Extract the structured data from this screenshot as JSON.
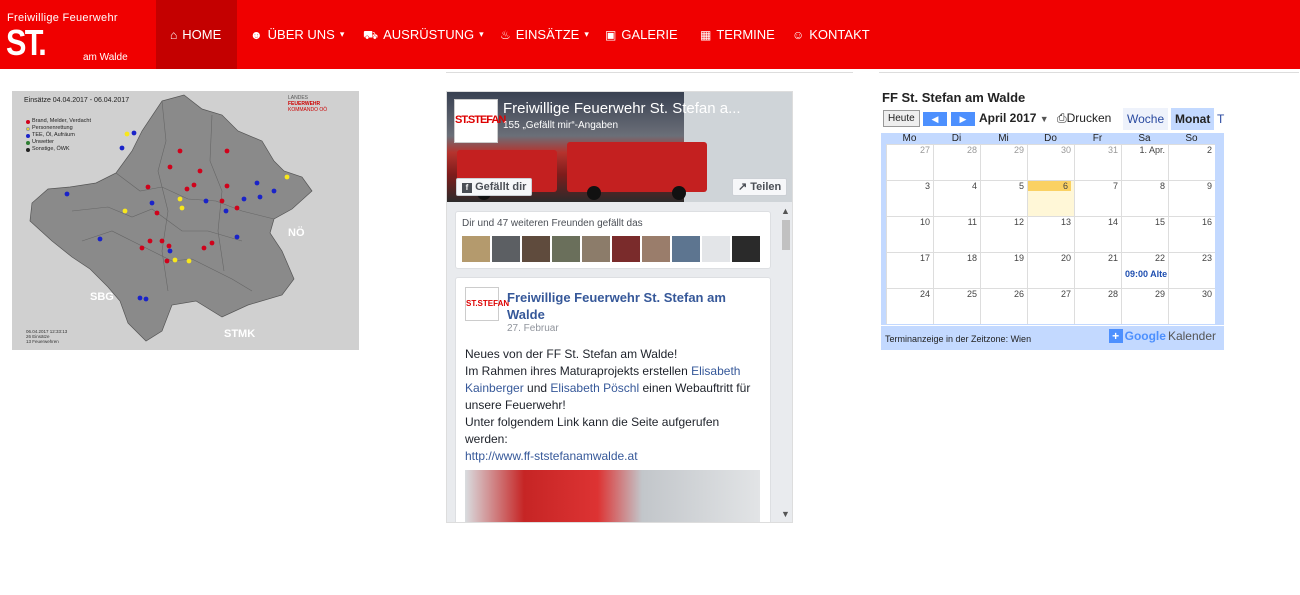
{
  "logo": {
    "top": "Freiwillige Feuerwehr",
    "main": "ST. STEFAN",
    "sub": "am Walde"
  },
  "nav": [
    {
      "icon": "home-icon",
      "glyph": "⌂",
      "label": "HOME",
      "active": true
    },
    {
      "icon": "users-icon",
      "glyph": "☻",
      "label": "ÜBER UNS",
      "caret": "▾"
    },
    {
      "icon": "truck-icon",
      "glyph": "⛟",
      "label": "AUSRÜSTUNG",
      "caret": "▾"
    },
    {
      "icon": "fire-icon",
      "glyph": "♨",
      "label": "EINSÄTZE",
      "caret": "▾"
    },
    {
      "icon": "picture-icon",
      "glyph": "▣",
      "label": "GALERIE"
    },
    {
      "icon": "calendar-icon",
      "glyph": "▦",
      "label": "TERMINE"
    },
    {
      "icon": "user-plus-icon",
      "glyph": "☺",
      "label": "KONTAKT"
    }
  ],
  "map": {
    "title": "Einsätze 04.04.2017 - 06.04.2017",
    "legend": [
      {
        "label": "Brand, Melder, Verdacht",
        "color": "#d0021b"
      },
      {
        "label": "Personenrettung",
        "color": "#f8e71c"
      },
      {
        "label": "TEE, Öl, Aufräum",
        "color": "#1a23c9"
      },
      {
        "label": "Unwetter",
        "color": "#2e7d32"
      },
      {
        "label": "Sonstige, ÖWK",
        "color": "#222222"
      }
    ],
    "badge": [
      "LANDES",
      "FEUERWEHR",
      "KOMMANDO OÖ"
    ],
    "footer": [
      "06.04.2017 12:33:13",
      "26 Einsätze",
      "13 Feuerwehren"
    ],
    "labels": {
      "bavaria": "",
      "noe": "NÖ",
      "sbg": "SBG",
      "stmk": "STMK"
    }
  },
  "facebook": {
    "page_name": "Freiwillige Feuerwehr St. Stefan a...",
    "likes": "155 „Gefällt mir“-Angaben",
    "like_button": "Gefällt dir",
    "share_button": "Teilen",
    "thumb_text": "ST.STEFAN",
    "friends_text": "Dir und 47 weiteren Freunden gefällt das",
    "post": {
      "title": "Freiwillige Feuerwehr St. Stefan am Walde",
      "date": "27. Februar",
      "line1": "Neues von der FF St. Stefan am Walde!",
      "line2a": "Im Rahmen ihres Maturaprojekts erstellen ",
      "name1": "Elisabeth Kainberger",
      "line2b": " und ",
      "name2": "Elisabeth Pöschl",
      "line2c": " einen Webauftritt für unsere Feuerwehr!",
      "line3": "Unter folgendem Link kann die Seite aufgerufen werden:",
      "link": "http://www.ff-ststefanamwalde.at"
    }
  },
  "calendar": {
    "title": "FF St. Stefan am Walde",
    "today_button": "Heute",
    "month": "April 2017",
    "print": "Drucken",
    "tabs": [
      "Woche",
      "Monat",
      "T"
    ],
    "weekdays": [
      "Mo",
      "Di",
      "Mi",
      "Do",
      "Fr",
      "Sa",
      "So"
    ],
    "weeks": [
      [
        "27",
        "28",
        "29",
        "30",
        "31",
        "1. Apr.",
        "2"
      ],
      [
        "3",
        "4",
        "5",
        "6",
        "7",
        "8",
        "9"
      ],
      [
        "10",
        "11",
        "12",
        "13",
        "14",
        "15",
        "16"
      ],
      [
        "17",
        "18",
        "19",
        "20",
        "21",
        "22",
        "23"
      ],
      [
        "24",
        "25",
        "26",
        "27",
        "28",
        "29",
        "30"
      ]
    ],
    "event": "09:00 Alte",
    "timezone": "Terminanzeige in der Zeitzone: Wien",
    "google_label": "Google",
    "kalender_label": "Kalender"
  }
}
